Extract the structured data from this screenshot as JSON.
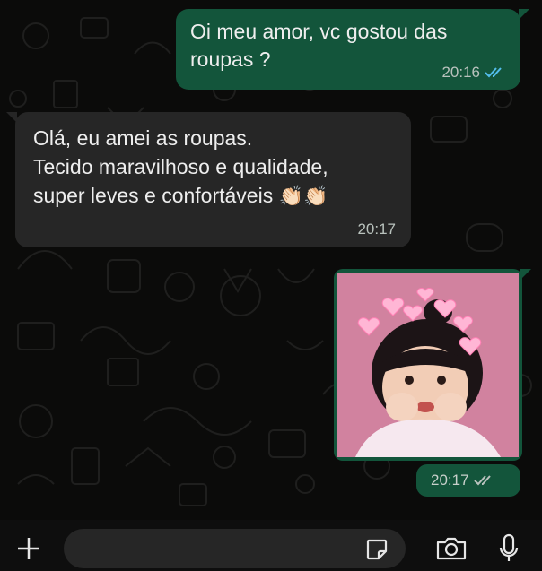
{
  "chat": {
    "messages": [
      {
        "direction": "outgoing",
        "type": "text",
        "text": "Oi meu amor, vc gostou das\nroupas ?",
        "time": "20:16",
        "status": "read"
      },
      {
        "direction": "incoming",
        "type": "text",
        "text": "Olá, eu amei as roupas.\nTecido maravilhoso e qualidade,\nsuper leves e confortáveis",
        "emoji": "👏🏻👏🏻",
        "time": "20:17"
      },
      {
        "direction": "outgoing",
        "type": "image",
        "image_subject": "photo of a young girl with pink heart filter",
        "time": "20:17",
        "status": "read"
      }
    ]
  },
  "composer": {
    "attach_icon": "plus-icon",
    "sticker_icon": "sticker-icon",
    "camera_icon": "camera-icon",
    "mic_icon": "microphone-icon"
  },
  "colors": {
    "outgoing_bubble": "#13553b",
    "incoming_bubble": "#262626",
    "read_ticks": "#53bdeb",
    "background": "#0b0b0a"
  }
}
